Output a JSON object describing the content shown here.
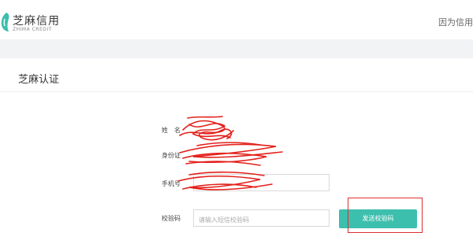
{
  "header": {
    "logo_cn": "芝麻信用",
    "logo_en": "ZHIMA CREDIT",
    "slogan": "因为信用"
  },
  "panel": {
    "title": "芝麻认证"
  },
  "form": {
    "name_label": "姓　名",
    "id_label": "身份证",
    "phone_label": "手机号",
    "code_label": "校验码",
    "code_placeholder": "请输入短信校验码",
    "send_button": "发送校验码"
  },
  "colors": {
    "brand_green": "#3dbfad",
    "highlight_red": "#e03030",
    "band_gray": "#f2f3f5"
  }
}
